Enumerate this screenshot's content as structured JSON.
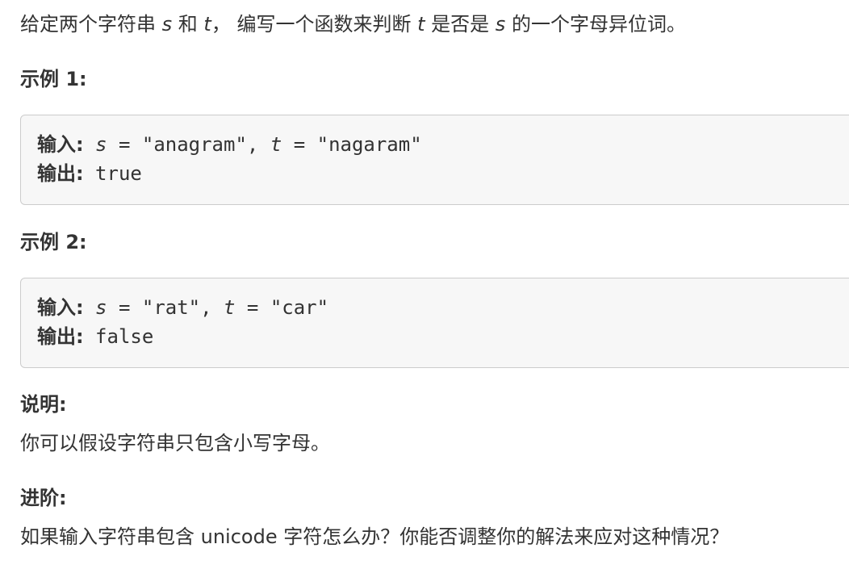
{
  "problem": {
    "intro_before_s": "给定两个字符串 ",
    "var_s": "s",
    "intro_and": " 和 ",
    "var_t": "t",
    "intro_mid": "， 编写一个函数来判断 ",
    "var_t2": "t",
    "intro_is": " 是否是 ",
    "var_s2": "s",
    "intro_end": " 的一个字母异位词。"
  },
  "example1": {
    "heading": "示例 1:",
    "input_label": "输入:",
    "s_var": "s",
    "s_eq": " = \"anagram\", ",
    "t_var": "t",
    "t_eq": " = \"nagaram\"",
    "output_label": "输出:",
    "output_value": " true"
  },
  "example2": {
    "heading": "示例 2:",
    "input_label": "输入:",
    "s_var": "s",
    "s_eq": " = \"rat\", ",
    "t_var": "t",
    "t_eq": " = \"car\"",
    "output_label": "输出:",
    "output_value": " false"
  },
  "note": {
    "heading": "说明:",
    "text": "你可以假设字符串只包含小写字母。"
  },
  "advanced": {
    "heading": "进阶:",
    "text": "如果输入字符串包含 unicode 字符怎么办？你能否调整你的解法来应对这种情况？"
  }
}
